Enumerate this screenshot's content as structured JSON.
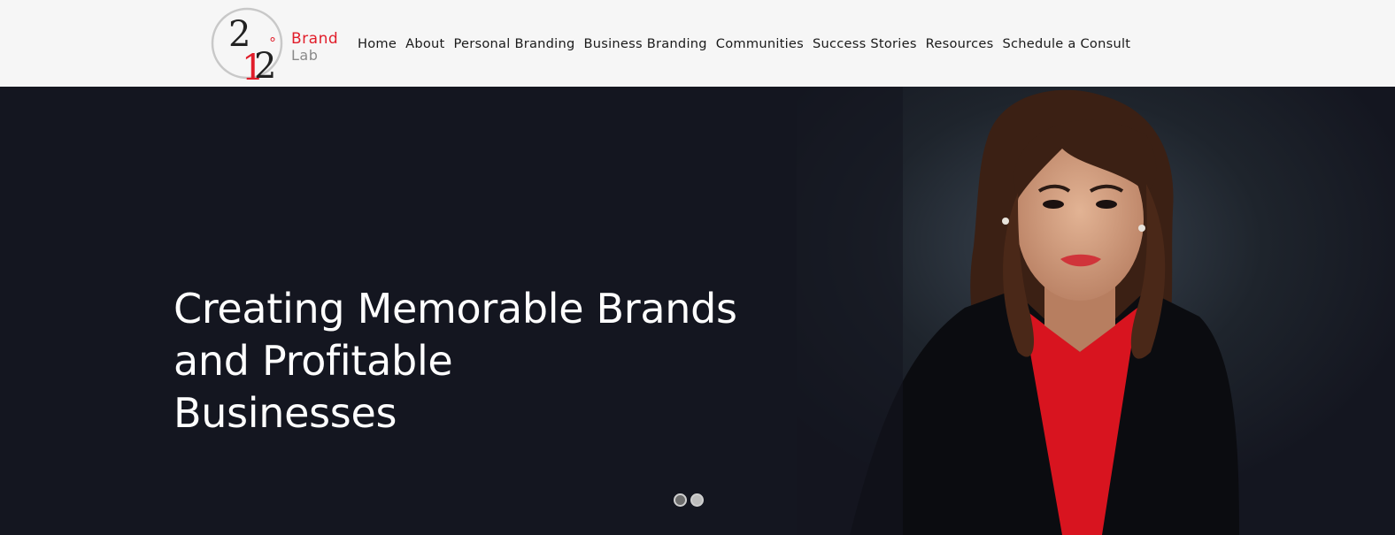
{
  "logo": {
    "numerals": [
      "2",
      "1",
      "2"
    ],
    "degree": "°",
    "word1": "Brand",
    "word2": "Lab",
    "colors": {
      "red": "#e11d2a",
      "dark": "#222222",
      "gray": "#8a8a8a"
    }
  },
  "nav": {
    "items": [
      {
        "label": "Home"
      },
      {
        "label": "About"
      },
      {
        "label": "Personal Branding"
      },
      {
        "label": "Business Branding"
      },
      {
        "label": "Communities"
      },
      {
        "label": "Success Stories"
      },
      {
        "label": "Resources"
      },
      {
        "label": "Schedule a Consult"
      }
    ]
  },
  "hero": {
    "headline_lines": [
      "Creating Memorable Brands",
      "and Profitable",
      "Businesses"
    ],
    "background": "#141620",
    "accent": "#d8141f"
  },
  "slider": {
    "dots": [
      {
        "state": "active"
      },
      {
        "state": "inactive"
      }
    ]
  }
}
